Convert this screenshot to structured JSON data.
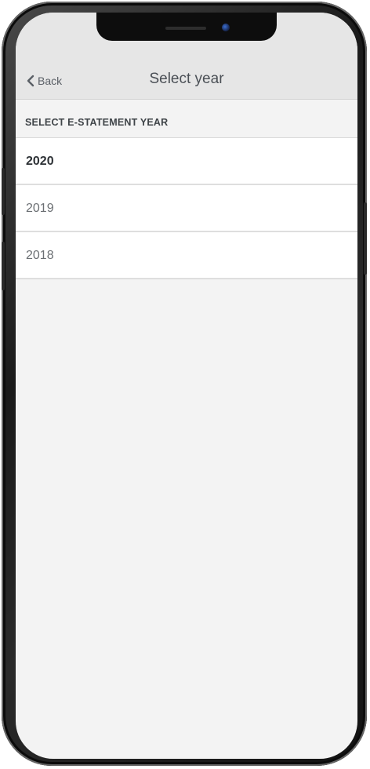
{
  "nav": {
    "back_label": "Back",
    "title": "Select year"
  },
  "section": {
    "header": "SELECT E-STATEMENT YEAR"
  },
  "years": [
    {
      "label": "2020",
      "selected": true
    },
    {
      "label": "2019",
      "selected": false
    },
    {
      "label": "2018",
      "selected": false
    }
  ],
  "colors": {
    "nav_background": "#e6e6e6",
    "screen_background": "#f3f3f3",
    "row_background": "#ffffff",
    "text_primary": "#2e3236",
    "text_secondary": "#6b6f73"
  },
  "icons": {
    "back": "chevron-left-icon"
  }
}
